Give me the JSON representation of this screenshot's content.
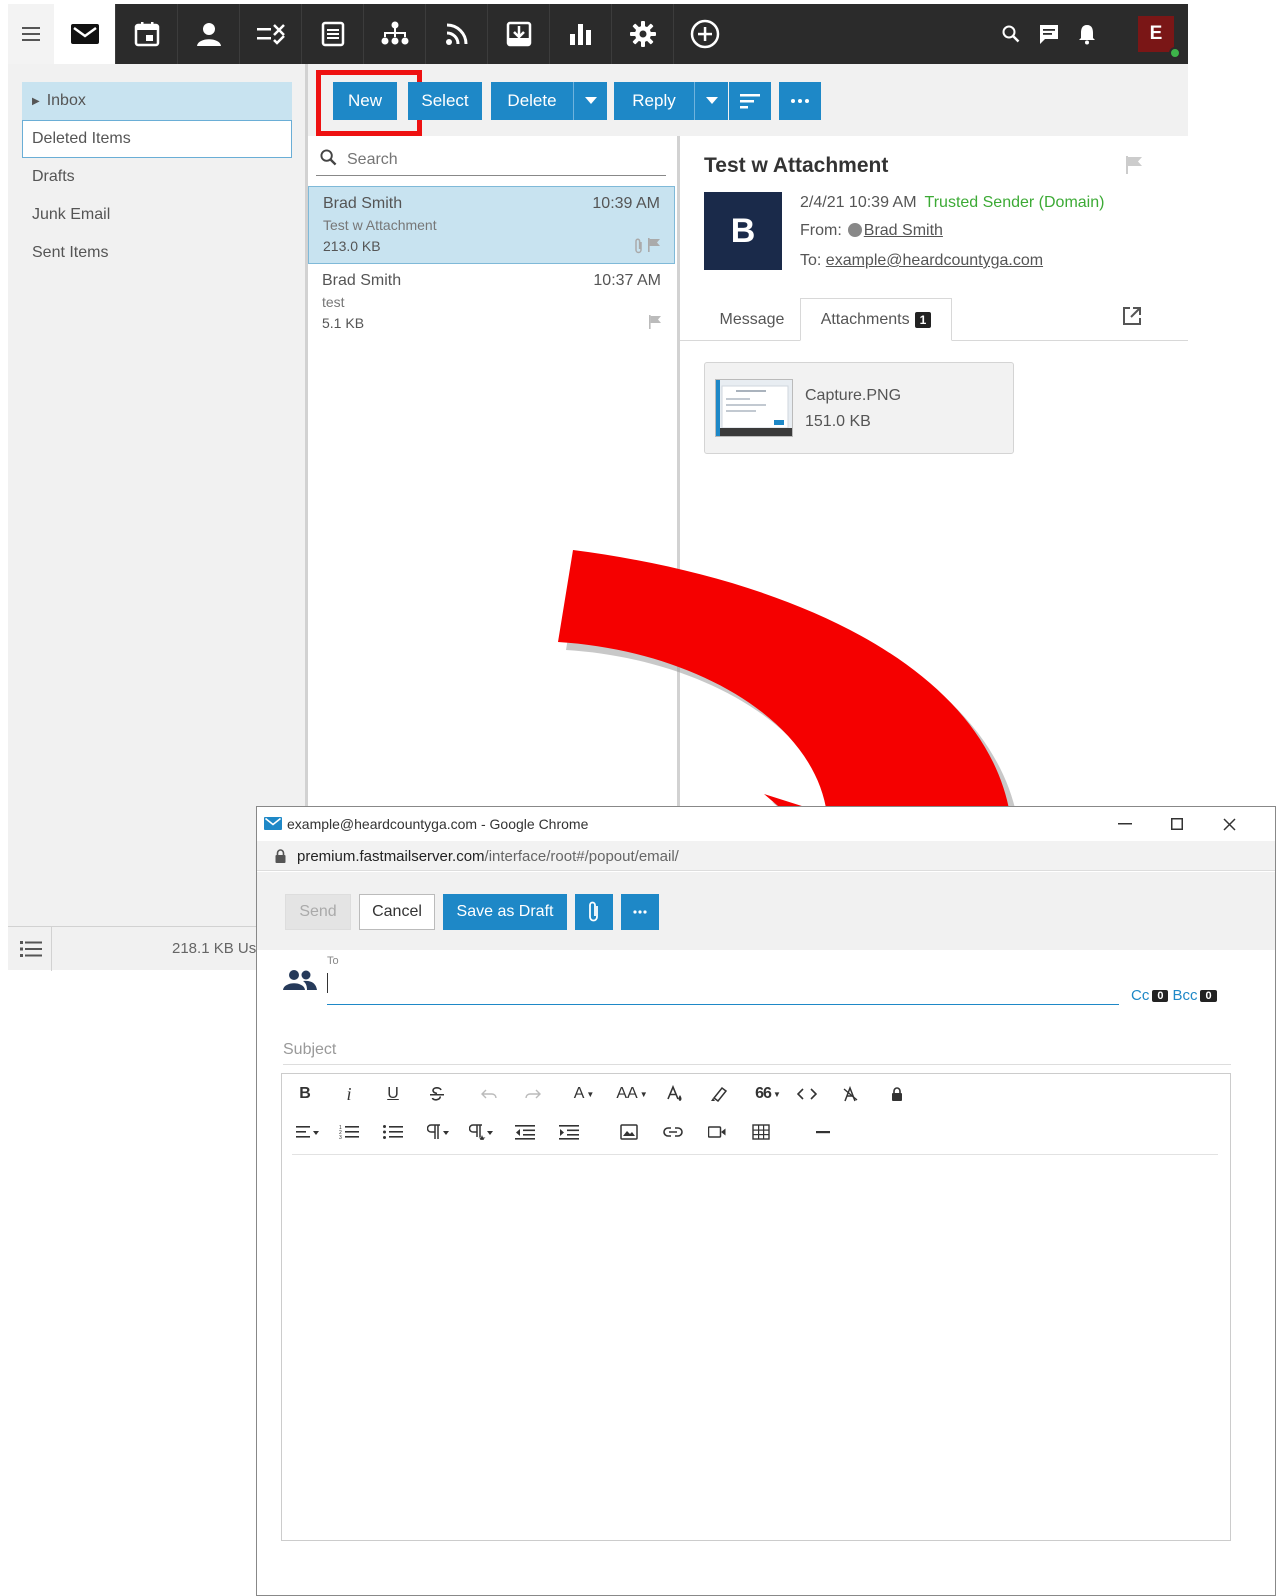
{
  "topnav": {
    "menu_icon": "hamburger-icon",
    "apps": [
      {
        "id": "mail",
        "icon": "envelope-icon",
        "active": true
      },
      {
        "id": "calendar",
        "icon": "calendar-icon"
      },
      {
        "id": "contacts",
        "icon": "person-icon"
      },
      {
        "id": "tasks",
        "icon": "tasks-icon"
      },
      {
        "id": "notes",
        "icon": "notes-icon"
      },
      {
        "id": "org",
        "icon": "org-chart-icon"
      },
      {
        "id": "rss",
        "icon": "rss-icon"
      },
      {
        "id": "archive",
        "icon": "archive-icon"
      },
      {
        "id": "reports",
        "icon": "bar-chart-icon"
      },
      {
        "id": "settings",
        "icon": "gear-icon"
      },
      {
        "id": "add",
        "icon": "plus-circle-icon"
      }
    ],
    "right_icons": [
      "search-icon",
      "chat-icon",
      "bell-icon"
    ],
    "user_initial": "E",
    "status_color": "#3db54a"
  },
  "sidebar": {
    "folders": [
      {
        "label": "Inbox",
        "selected": true
      },
      {
        "label": "Deleted Items",
        "focused": true
      },
      {
        "label": "Drafts"
      },
      {
        "label": "Junk Email"
      },
      {
        "label": "Sent Items"
      }
    ],
    "storage": "218.1 KB Us"
  },
  "toolbar": {
    "new_label": "New",
    "select_label": "Select",
    "delete_label": "Delete",
    "reply_label": "Reply",
    "accent": "#1e88c7",
    "highlight_color": "#ee1111"
  },
  "message_list": {
    "search_placeholder": "Search",
    "messages": [
      {
        "from": "Brad Smith",
        "subject": "Test w Attachment",
        "time": "10:39 AM",
        "size": "213.0 KB",
        "selected": true,
        "has_attachment": true
      },
      {
        "from": "Brad Smith",
        "subject": "test",
        "time": "10:37 AM",
        "size": "5.1 KB",
        "selected": false,
        "has_attachment": false
      }
    ]
  },
  "reading": {
    "subject": "Test w Attachment",
    "avatar_letter": "B",
    "date": "2/4/21 10:39 AM",
    "trust": "Trusted Sender (Domain)",
    "from_label": "From:",
    "from_name": "Brad Smith",
    "to_label": "To:",
    "to_address": "example@heardcountyga.com",
    "tab_message": "Message",
    "tab_attachments": "Attachments",
    "attachment_count": "1",
    "attachment": {
      "name": "Capture.PNG",
      "size": "151.0 KB"
    }
  },
  "popout": {
    "window_title": "example@heardcountyga.com - Google Chrome",
    "url_host": "premium.fastmailserver.com",
    "url_path": "/interface/root#/popout/email/",
    "send_label": "Send",
    "cancel_label": "Cancel",
    "save_draft_label": "Save as Draft",
    "to_label": "To",
    "cc_label": "Cc",
    "cc_count": "0",
    "bcc_label": "Bcc",
    "bcc_count": "0",
    "subject_placeholder": "Subject",
    "editor": {
      "bold": "B",
      "italic": "i",
      "underline": "U",
      "font_size": "A",
      "font_case": "AA",
      "quote": "66"
    }
  }
}
